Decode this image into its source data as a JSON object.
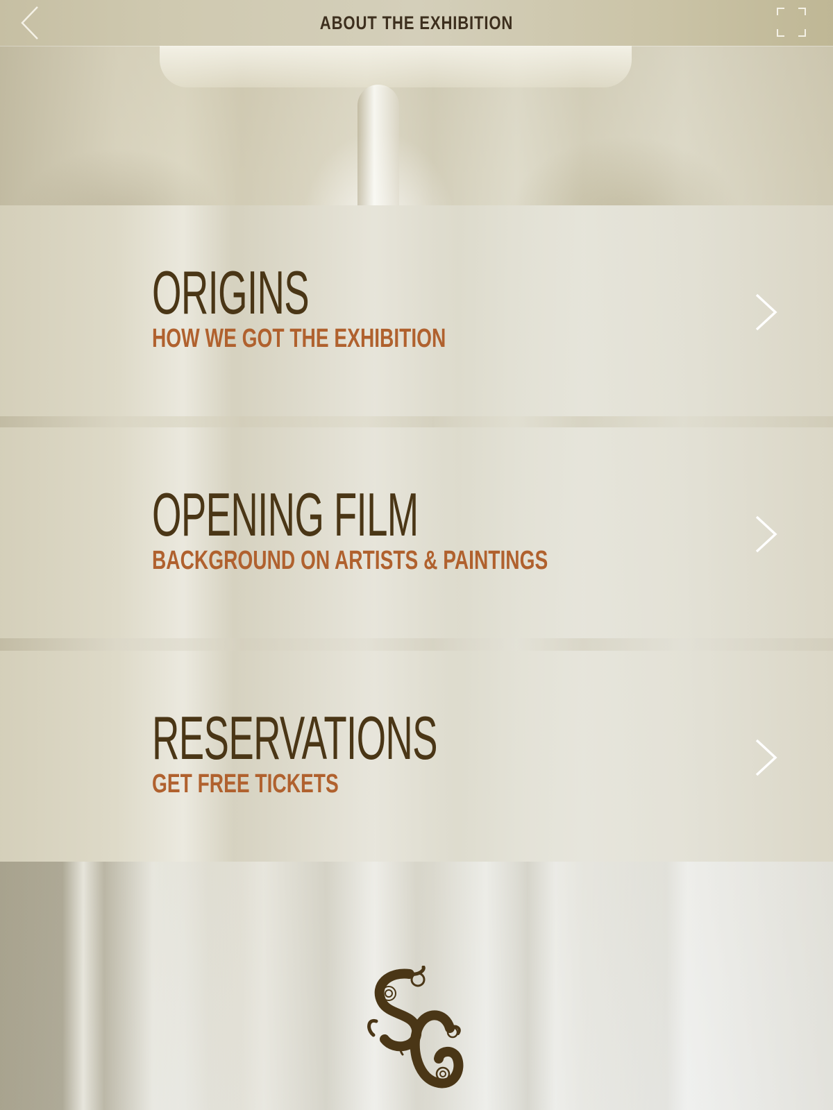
{
  "header": {
    "title": "ABOUT THE EXHIBITION",
    "back_icon": "chevron-left-icon",
    "fullscreen_icon": "fullscreen-icon"
  },
  "menu": {
    "items": [
      {
        "title": "ORIGINS",
        "subtitle": "HOW WE GOT THE EXHIBITION",
        "icon": "chevron-right-icon"
      },
      {
        "title": "OPENING FILM",
        "subtitle": "BACKGROUND ON ARTISTS & PAINTINGS",
        "icon": "chevron-right-icon"
      },
      {
        "title": "RESERVATIONS",
        "subtitle": "GET FREE TICKETS",
        "icon": "chevron-right-icon"
      }
    ]
  },
  "footer": {
    "logo": "monogram-logo"
  },
  "colors": {
    "title_text": "#4a3616",
    "subtitle_text": "#b0612e",
    "header_text": "#3d2f1e",
    "chevron": "#ffffff"
  }
}
